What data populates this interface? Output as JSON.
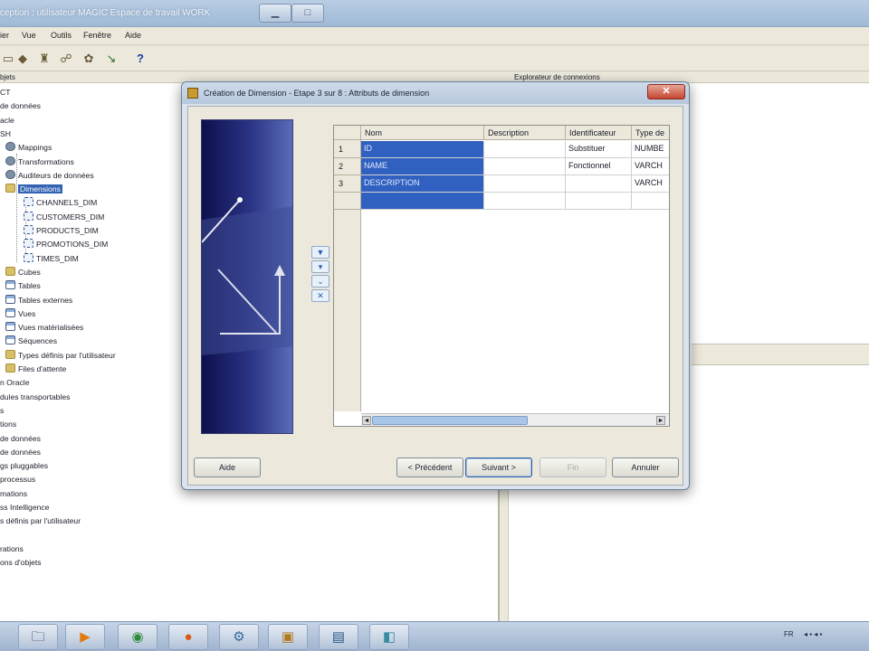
{
  "window": {
    "title": "ception : utilisateur MAGIC   Espace de travail WORK"
  },
  "menubar": {
    "items": [
      "ier",
      "Vue",
      "Outils",
      "Fenêtre",
      "Aide"
    ]
  },
  "toolbar": {
    "icons": [
      "copy-icon",
      "tag-icon",
      "stamp-icon",
      "connect-icon",
      "deploy-icon",
      "arrow-icon",
      "help-icon"
    ],
    "help_glyph": "?"
  },
  "left_panel": {
    "header": "bjets",
    "tree": [
      {
        "label": "CT",
        "icon": ""
      },
      {
        "label": "de données",
        "icon": ""
      },
      {
        "label": "acle",
        "icon": ""
      },
      {
        "label": "SH",
        "icon": ""
      },
      {
        "label": "Mappings",
        "icon": "gear"
      },
      {
        "label": "Transformations",
        "icon": "gear"
      },
      {
        "label": "Auditeurs de données",
        "icon": "gear"
      },
      {
        "label": "Dimensions",
        "icon": "folder",
        "selected": true
      },
      {
        "label": "CHANNELS_DIM",
        "icon": "dim"
      },
      {
        "label": "CUSTOMERS_DIM",
        "icon": "dim"
      },
      {
        "label": "PRODUCTS_DIM",
        "icon": "dim"
      },
      {
        "label": "PROMOTIONS_DIM",
        "icon": "dim"
      },
      {
        "label": "TIMES_DIM",
        "icon": "dim"
      },
      {
        "label": "Cubes",
        "icon": "folder"
      },
      {
        "label": "Tables",
        "icon": "table"
      },
      {
        "label": "Tables externes",
        "icon": "table"
      },
      {
        "label": "Vues",
        "icon": "table"
      },
      {
        "label": "Vues matérialisées",
        "icon": "table"
      },
      {
        "label": "Séquences",
        "icon": "table"
      },
      {
        "label": "Types définis par l'utilisateur",
        "icon": "folder"
      },
      {
        "label": "Files d'attente",
        "icon": "folder"
      },
      {
        "label": "n Oracle",
        "icon": ""
      },
      {
        "label": "dules transportables",
        "icon": ""
      },
      {
        "label": "s",
        "icon": ""
      },
      {
        "label": "tions",
        "icon": ""
      },
      {
        "label": "de données",
        "icon": ""
      },
      {
        "label": "de données",
        "icon": ""
      },
      {
        "label": "gs pluggables",
        "icon": ""
      },
      {
        "label": "processus",
        "icon": ""
      },
      {
        "label": "mations",
        "icon": ""
      },
      {
        "label": "ss Intelligence",
        "icon": ""
      },
      {
        "label": "s définis par l'utilisateur",
        "icon": ""
      },
      {
        "label": "",
        "icon": ""
      },
      {
        "label": "rations",
        "icon": ""
      },
      {
        "label": "ons d'objets",
        "icon": ""
      }
    ]
  },
  "right_panel": {
    "header": "Explorateur de connexions"
  },
  "dialog": {
    "title": "Création de Dimension - Etape 3 sur 8 : Attributs de dimension",
    "close_glyph": "✕",
    "move_buttons": [
      "move-top",
      "move-up",
      "move-down",
      "move-bottom"
    ],
    "grid": {
      "columns": [
        "Nom",
        "Description",
        "Identificateur",
        "Type de"
      ],
      "rows": [
        {
          "num": "1",
          "name": "ID",
          "description": "",
          "identifier": "Substituer",
          "type": "NUMBE"
        },
        {
          "num": "2",
          "name": "NAME",
          "description": "",
          "identifier": "Fonctionnel",
          "type": "VARCH"
        },
        {
          "num": "3",
          "name": "DESCRIPTION",
          "description": "",
          "identifier": "",
          "type": "VARCH"
        },
        {
          "num": "",
          "name": "",
          "description": "",
          "identifier": "",
          "type": ""
        }
      ],
      "scroll_left": "◄",
      "scroll_right": "►"
    },
    "buttons": {
      "help": "Aide",
      "previous": "< Précédent",
      "next": "Suivant >",
      "finish": "Fin",
      "cancel": "Annuler"
    }
  },
  "taskbar": {
    "apps": [
      "explorer-icon",
      "media-player-icon",
      "network-icon",
      "firefox-icon",
      "tools-icon",
      "archive-icon",
      "window-icon",
      "app-icon"
    ],
    "tray_lang": "FR"
  }
}
